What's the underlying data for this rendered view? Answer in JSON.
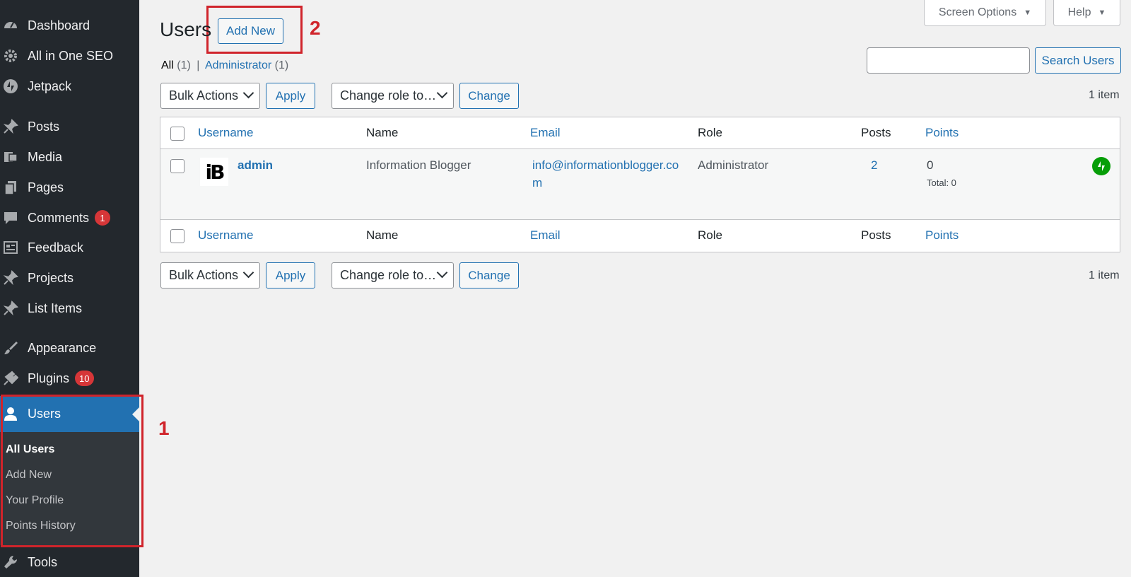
{
  "sidebar": {
    "items": [
      {
        "label": "Dashboard",
        "icon": "dashboard-icon"
      },
      {
        "label": "All in One SEO",
        "icon": "gear-icon"
      },
      {
        "label": "Jetpack",
        "icon": "jetpack-icon"
      },
      {
        "label": "Posts",
        "icon": "pin-icon"
      },
      {
        "label": "Media",
        "icon": "media-icon"
      },
      {
        "label": "Pages",
        "icon": "pages-icon"
      },
      {
        "label": "Comments",
        "icon": "comment-icon",
        "badge": "1"
      },
      {
        "label": "Feedback",
        "icon": "feedback-icon"
      },
      {
        "label": "Projects",
        "icon": "pin-icon"
      },
      {
        "label": "List Items",
        "icon": "pin-icon"
      },
      {
        "label": "Appearance",
        "icon": "brush-icon"
      },
      {
        "label": "Plugins",
        "icon": "plugin-icon",
        "badge": "10"
      },
      {
        "label": "Users",
        "icon": "user-icon",
        "current": true
      },
      {
        "label": "Tools",
        "icon": "wrench-icon"
      }
    ],
    "submenu": [
      "All Users",
      "Add New",
      "Your Profile",
      "Points History"
    ]
  },
  "annotations": {
    "one": "1",
    "two": "2"
  },
  "header": {
    "screen_options": "Screen Options",
    "help": "Help",
    "title": "Users",
    "add_new": "Add New"
  },
  "filters": {
    "all": "All",
    "all_count": "(1)",
    "separator": "|",
    "administrator": "Administrator",
    "administrator_count": "(1)"
  },
  "search": {
    "button": "Search Users",
    "value": ""
  },
  "tablenav": {
    "bulk_actions": "Bulk Actions",
    "apply": "Apply",
    "change_role": "Change role to…",
    "change": "Change",
    "count": "1 item"
  },
  "table": {
    "columns": [
      "Username",
      "Name",
      "Email",
      "Role",
      "Posts",
      "Points"
    ],
    "rows": [
      {
        "avatar_text": "iB",
        "username": "admin",
        "name": "Information Blogger",
        "email_line1": "info@informationblogger.co",
        "email_line2": "m",
        "role": "Administrator",
        "posts": "2",
        "points": "0",
        "points_total": "Total: 0"
      }
    ]
  },
  "colors": {
    "accent": "#2271b1",
    "sidebar": "#23282d",
    "current": "#2271b1",
    "annotation": "#d0242b",
    "badge": "#d63638"
  }
}
